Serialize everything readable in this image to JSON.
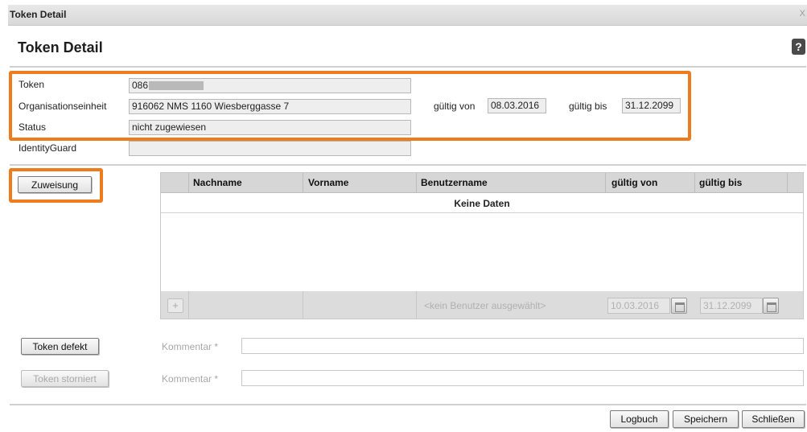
{
  "window": {
    "title": "Token Detail",
    "close_glyph": "X"
  },
  "page": {
    "title": "Token Detail",
    "help_glyph": "?"
  },
  "fields": {
    "token_label": "Token",
    "token_value": "086",
    "org_label": "Organisationseinheit",
    "org_value": "916062 NMS 1160 Wiesberggasse 7",
    "status_label": "Status",
    "status_value": "nicht zugewiesen",
    "identity_label": "IdentityGuard",
    "identity_value": "",
    "valid_from_label": "gültig von",
    "valid_from_value": "08.03.2016",
    "valid_to_label": "gültig bis",
    "valid_to_value": "31.12.2099"
  },
  "assign_button": "Zuweisung",
  "grid": {
    "columns": [
      "Nachname",
      "Vorname",
      "Benutzername",
      "gültig von",
      "gültig bis"
    ],
    "no_data": "Keine Daten",
    "footer": {
      "add_glyph": "+",
      "user_placeholder": "<kein Benutzer ausgewählt>",
      "from_date": "10.03.2016",
      "to_date": "31.12.2099"
    }
  },
  "defect": {
    "button": "Token defekt",
    "comment_label": "Kommentar *"
  },
  "cancelled": {
    "button": "Token storniert",
    "comment_label": "Kommentar *"
  },
  "actions": {
    "logbook": "Logbuch",
    "save": "Speichern",
    "close": "Schließen"
  },
  "colors": {
    "highlight": "#ee7b1d",
    "header_bg": "#d6d6d6"
  },
  "icons": {
    "help": "help-icon",
    "close": "close-icon",
    "calendar": "calendar-icon",
    "add": "plus-icon"
  }
}
